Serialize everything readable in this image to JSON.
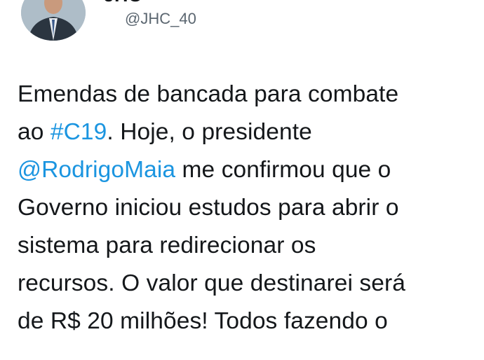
{
  "tweet": {
    "author": {
      "display_name": "JHC",
      "handle": "@JHC_40",
      "verified": true,
      "verified_icon": "verified-badge-icon"
    },
    "text_lines": [
      [
        {
          "text": "Emendas de bancada para combate"
        }
      ],
      [
        {
          "text": "ao "
        },
        {
          "text": "#C19",
          "link": true,
          "kind": "hashtag"
        },
        {
          "text": ". Hoje, o presidente"
        }
      ],
      [
        {
          "text": "@RodrigoMaia",
          "link": true,
          "kind": "mention"
        },
        {
          "text": " me confirmou que o"
        }
      ],
      [
        {
          "text": "Governo iniciou estudos para abrir o"
        }
      ],
      [
        {
          "text": "sistema para redirecionar os"
        }
      ],
      [
        {
          "text": "recursos. O valor que destinarei será"
        }
      ],
      [
        {
          "text": "de R$ 20 milhões! Todos fazendo o"
        }
      ]
    ]
  },
  "colors": {
    "text": "#14171a",
    "secondary": "#5b6670",
    "link": "#1b95e0",
    "verified": "#1da1f2",
    "background": "#ffffff"
  }
}
